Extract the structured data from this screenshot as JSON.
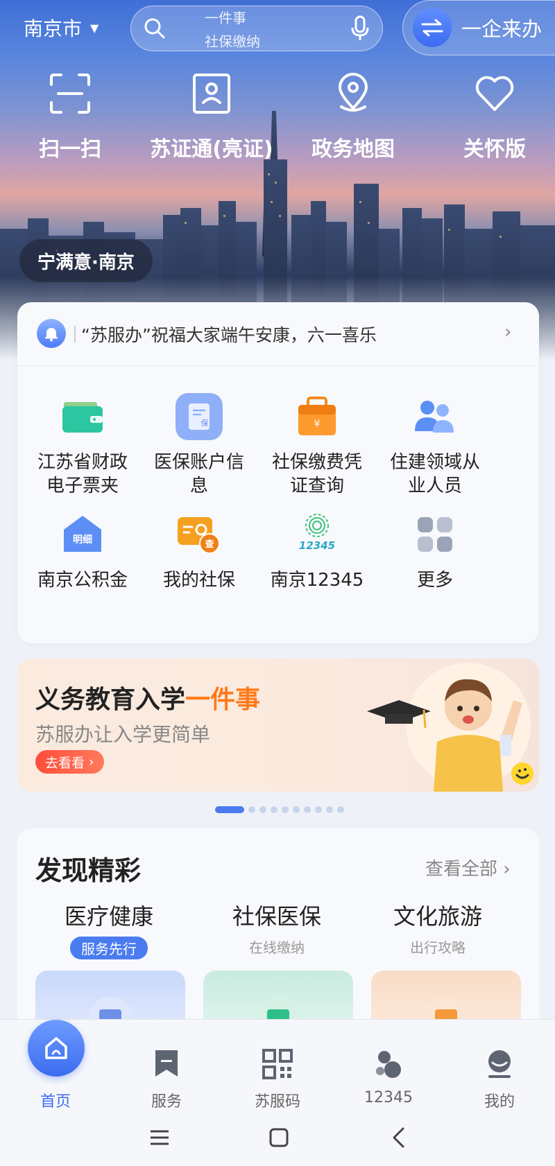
{
  "header": {
    "city": "南京市",
    "search_hints": [
      "一件事",
      "社保缴纳"
    ],
    "enterprise_label": "一企来办"
  },
  "quick_actions": [
    {
      "label": "扫一扫",
      "icon": "scan-icon"
    },
    {
      "label": "苏证通(亮证)",
      "icon": "id-card-icon"
    },
    {
      "label": "政务地图",
      "icon": "map-pin-icon"
    },
    {
      "label": "关怀版",
      "icon": "heart-icon"
    }
  ],
  "tagline": "宁满意·南京",
  "notice": {
    "text": "“苏服办”祝福大家端午安康，六一喜乐"
  },
  "services": [
    {
      "label": "江苏省财政电子票夹",
      "line1": "江苏省财政",
      "line2": "电子票夹",
      "icon": "wallet-icon"
    },
    {
      "label": "医保账户信息",
      "line1": "医保账户信",
      "line2": "息",
      "icon": "medical-insurance-icon"
    },
    {
      "label": "社保缴费凭证查询",
      "line1": "社保缴费凭",
      "line2": "证查询",
      "icon": "receipt-bag-icon"
    },
    {
      "label": "住建领域从业人员",
      "line1": "住建领域从",
      "line2": "业人员",
      "icon": "people-icon"
    },
    {
      "label": "南京公积金",
      "line1": "南京公积金",
      "line2": "",
      "icon": "housing-fund-icon"
    },
    {
      "label": "我的社保",
      "line1": "我的社保",
      "line2": "",
      "icon": "social-security-icon"
    },
    {
      "label": "南京12345",
      "line1": "南京12345",
      "line2": "",
      "icon": "hotline-12345-icon"
    },
    {
      "label": "更多",
      "line1": "更多",
      "line2": "",
      "icon": "more-grid-icon"
    }
  ],
  "service_icon_texts": {
    "housing": "明细",
    "security": "查",
    "medical": "保",
    "hotline": "12345"
  },
  "banner": {
    "title_main": "义务教育入学",
    "title_accent": "一件事",
    "subtitle": "苏服办让入学更简单",
    "button": "去看看"
  },
  "carousel": {
    "total": 10,
    "active": 0
  },
  "discover": {
    "title": "发现精彩",
    "view_all": "查看全部",
    "categories": [
      {
        "name": "医疗健康",
        "sub": "服务先行"
      },
      {
        "name": "社保医保",
        "sub": "在线缴纳"
      },
      {
        "name": "文化旅游",
        "sub": "出行攻略"
      }
    ]
  },
  "bottom_nav": [
    {
      "label": "首页",
      "icon": "home-icon",
      "active": true
    },
    {
      "label": "服务",
      "icon": "bookmark-icon",
      "active": false
    },
    {
      "label": "苏服码",
      "icon": "qr-code-icon",
      "active": false
    },
    {
      "label": "12345",
      "icon": "hotline-icon",
      "active": false
    },
    {
      "label": "我的",
      "icon": "profile-icon",
      "active": false
    }
  ],
  "colors": {
    "accent": "#3c6cf0",
    "banner_accent": "#ff7a1a",
    "button_red": "#ff4d3a"
  }
}
